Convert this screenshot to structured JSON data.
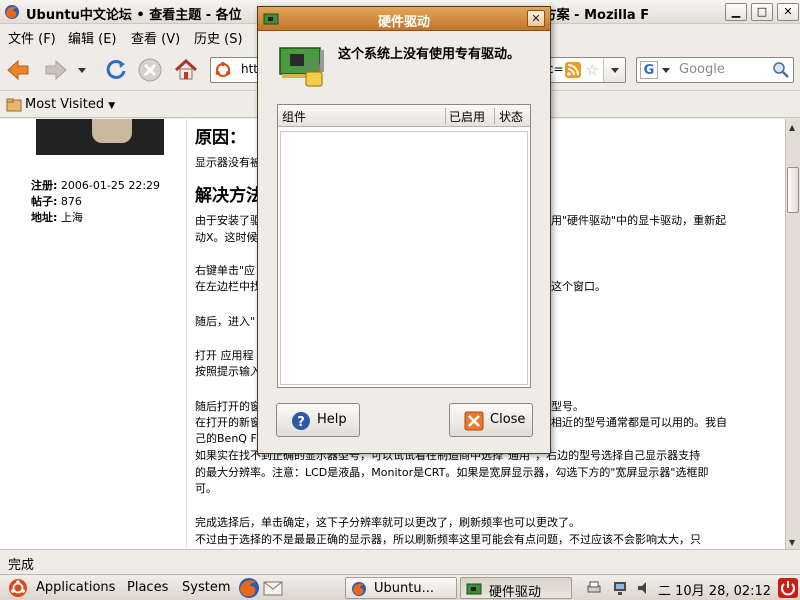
{
  "window": {
    "title": "Ubuntu中文论坛 • 查看主题 - 各位 ... 图形解决方案 - Mozilla F",
    "title_left": "Ubuntu中文论坛 • 查看主题 - 各位",
    "title_right": "图形解决方案 - Mozilla F"
  },
  "menubar": {
    "items": [
      "文件 (F)",
      "编辑 (E)",
      "查看 (V)",
      "历史 (S)"
    ]
  },
  "navbar": {
    "url_text": "htt",
    "url_tail": "c=",
    "search_placeholder": "Google"
  },
  "bookmarks": {
    "label": "Most Visited"
  },
  "post": {
    "reg_label": "注册:",
    "reg_value": "2006-01-25 22:29",
    "posts_label": "帖子:",
    "posts_value": "876",
    "loc_label": "地址:",
    "loc_value": "上海",
    "heading1": "原因：",
    "line1": "显示器没有被",
    "heading2": "解决方法",
    "line2a": "由于安装了驱",
    "line2b": "用\"硬件驱动\"中的显卡驱动，重新起",
    "line2c": "动X。这时候",
    "line3a": "右键单击\"应",
    "line3b": "在左边栏中找",
    "line3c": "这个窗口。",
    "line4": "随后，进入\"",
    "line5a": "打开 应用程",
    "line5b": "按照提示输入",
    "line6a": "随后打开的窗",
    "line6b": "型号。",
    "line6c": "在打开的新窗",
    "line6d": "相近的型号通常都是可以用的。我自",
    "line6e": "己的BenQ F",
    "line7a": "如果实在找不到正确的显示器型号，可以试试看在制造商中选择\"通用\"，右边的型号选择自己显示器支持",
    "line7b": "的最大分辨率。注意：LCD是液晶，Monitor是CRT。如果是宽屏显示器，勾选下方的\"宽屏显示器\"选框即",
    "line7c": "可。",
    "line8a": "完成选择后，单击确定，这下子分辨率就可以更改了，刷新频率也可以更改了。",
    "line8b": "不过由于选择的不是最最正确的显示器，所以刷新频率这里可能会有点问题，不过应该不会影响太大，只"
  },
  "statusbar": {
    "text": "完成"
  },
  "panel": {
    "applications": "Applications",
    "places": "Places",
    "system": "System",
    "task1": "Ubuntu...",
    "task2": "硬件驱动",
    "clock": "二 10月 28, 02:12"
  },
  "dialog": {
    "title": "硬件驱动",
    "message": "这个系统上没有使用专有驱动。",
    "columns": [
      "组件",
      "已启用",
      "状态"
    ],
    "help_label": "Help",
    "close_label": "Close"
  },
  "colors": {
    "dialog_title": "#c97c2e",
    "panel": "#e4dfd8"
  }
}
